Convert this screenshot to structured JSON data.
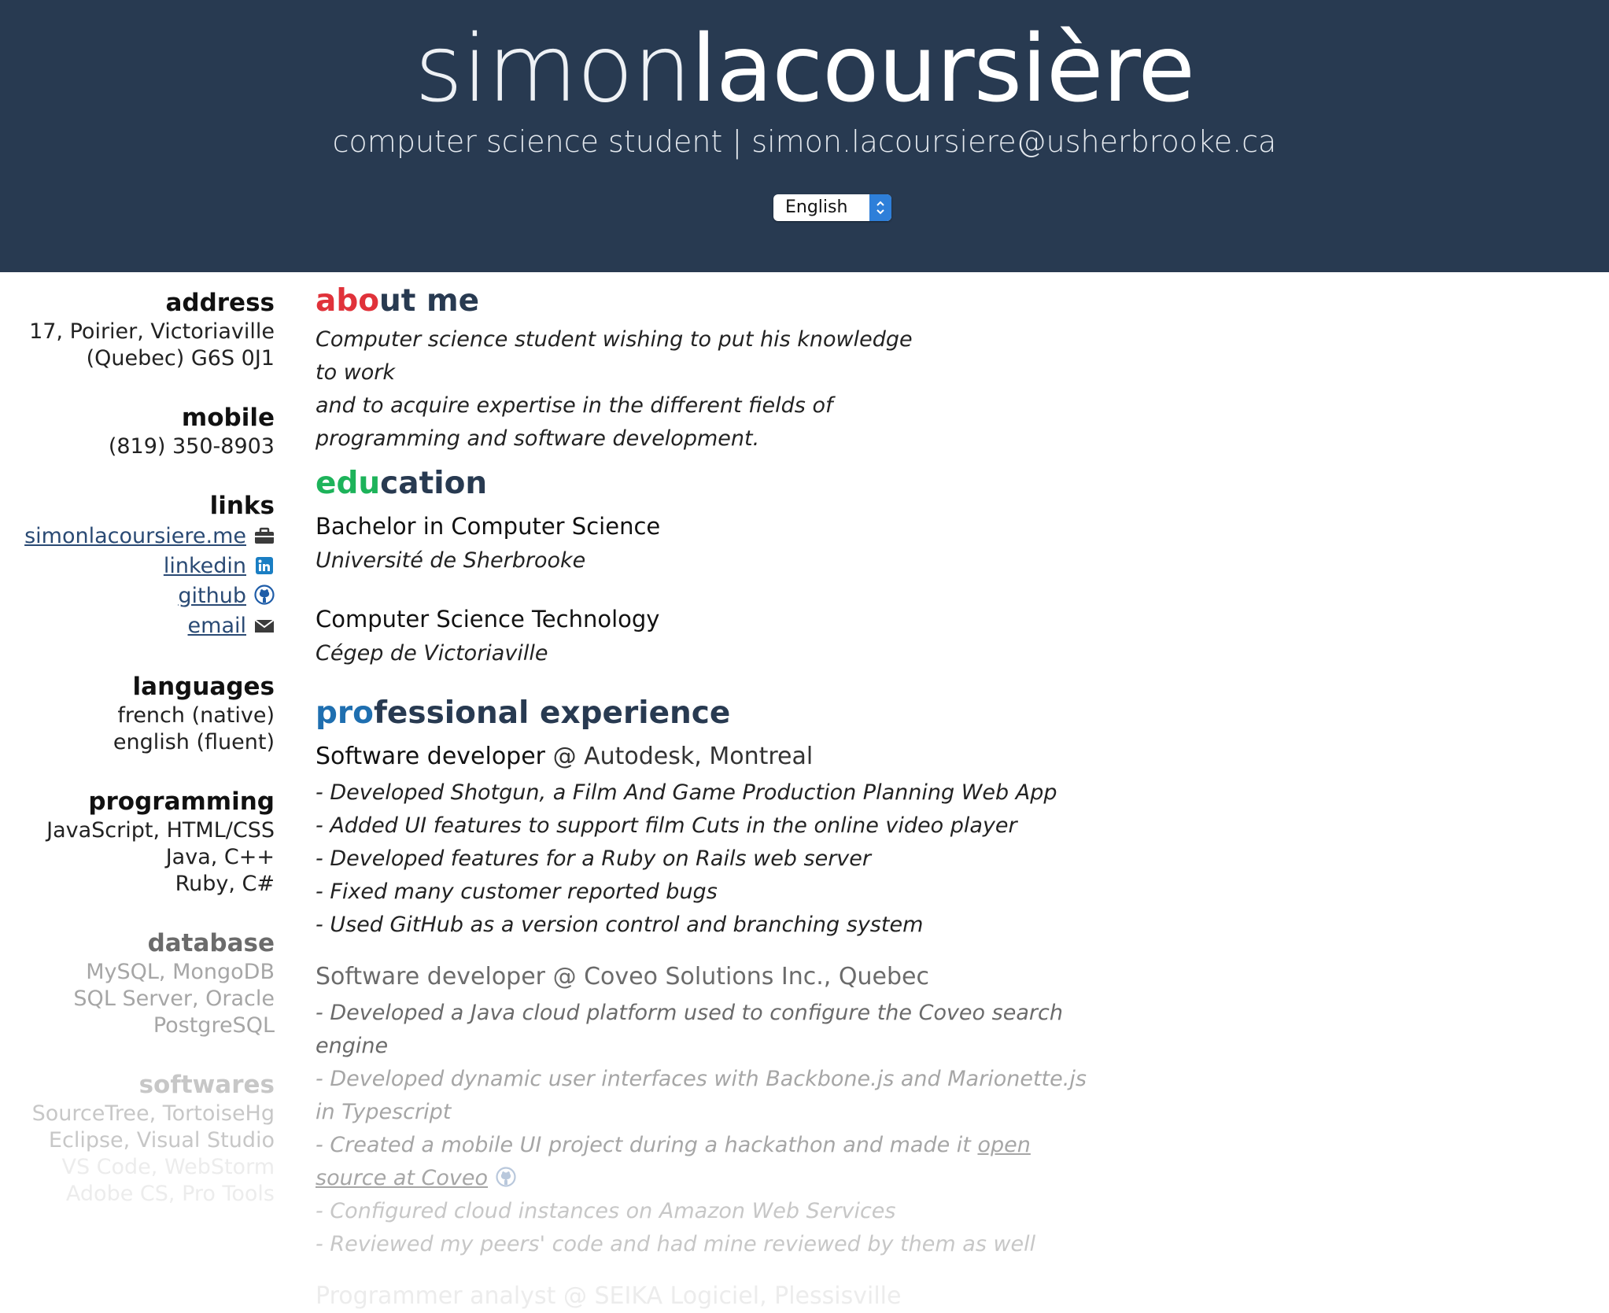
{
  "header": {
    "first_name": "simon",
    "last_name": "lacoursière",
    "tagline": "computer science student | simon.lacoursiere@usherbrooke.ca",
    "language_select": {
      "value": "English"
    }
  },
  "sidebar": {
    "address": {
      "title": "address",
      "lines": [
        "17, Poirier, Victoriaville",
        "(Quebec) G6S 0J1"
      ]
    },
    "mobile": {
      "title": "mobile",
      "lines": [
        "(819) 350-8903"
      ]
    },
    "links": {
      "title": "links",
      "items": [
        {
          "label": "simonlacoursiere.me",
          "icon": "briefcase-icon"
        },
        {
          "label": "linkedin",
          "icon": "linkedin-icon"
        },
        {
          "label": "github",
          "icon": "github-icon"
        },
        {
          "label": "email",
          "icon": "envelope-icon"
        }
      ]
    },
    "languages": {
      "title": "languages",
      "lines": [
        "french (native)",
        "english (fluent)"
      ]
    },
    "programming": {
      "title": "programming",
      "lines": [
        "JavaScript, HTML/CSS",
        "Java, C++",
        "Ruby, C#"
      ]
    },
    "database": {
      "title": "database",
      "lines": [
        "MySQL, MongoDB",
        "SQL Server, Oracle",
        "PostgreSQL"
      ]
    },
    "softwares": {
      "title": "softwares",
      "lines": [
        "SourceTree, TortoiseHg",
        "Eclipse, Visual Studio",
        "VS Code, WebStorm",
        "Adobe CS, Pro Tools"
      ]
    }
  },
  "main": {
    "about": {
      "title_accent": "abo",
      "title_rest": "ut me",
      "text_lines": [
        "Computer science student wishing to put his knowledge to work",
        "and to acquire expertise in the different fields of",
        "programming and software development."
      ]
    },
    "education": {
      "title_accent": "edu",
      "title_rest": "cation",
      "items": [
        {
          "degree": "Bachelor in Computer Science",
          "school": "Université de Sherbrooke"
        },
        {
          "degree": "Computer Science Technology",
          "school": "Cégep de Victoriaville"
        }
      ]
    },
    "experience": {
      "title_accent": "pro",
      "title_rest": "fessional experience",
      "jobs": [
        {
          "role": "Software developer",
          "company": "@ Autodesk, Montreal",
          "bullets": [
            "- Developed Shotgun, a Film And Game Production Planning Web App",
            "- Added UI features to support film Cuts in the online video player",
            "- Developed features for a Ruby on Rails web server",
            "- Fixed many customer reported bugs",
            "- Used GitHub as a version control and branching system"
          ]
        },
        {
          "role": "Software developer",
          "company": "@ Coveo Solutions Inc., Quebec",
          "bullets": [
            "- Developed a Java cloud platform used to configure the Coveo search engine",
            "- Developed dynamic user interfaces with Backbone.js and Marionette.js in Typescript",
            "- Created a mobile UI project during a hackathon and made it ",
            "- Configured cloud instances on Amazon Web Services",
            "- Reviewed my peers' code and had mine reviewed by them as well"
          ],
          "bullet3_link": "open source at Coveo"
        },
        {
          "role": "Programmer analyst",
          "company": "@ SEIKA Logiciel, Plessisville"
        }
      ]
    }
  }
}
